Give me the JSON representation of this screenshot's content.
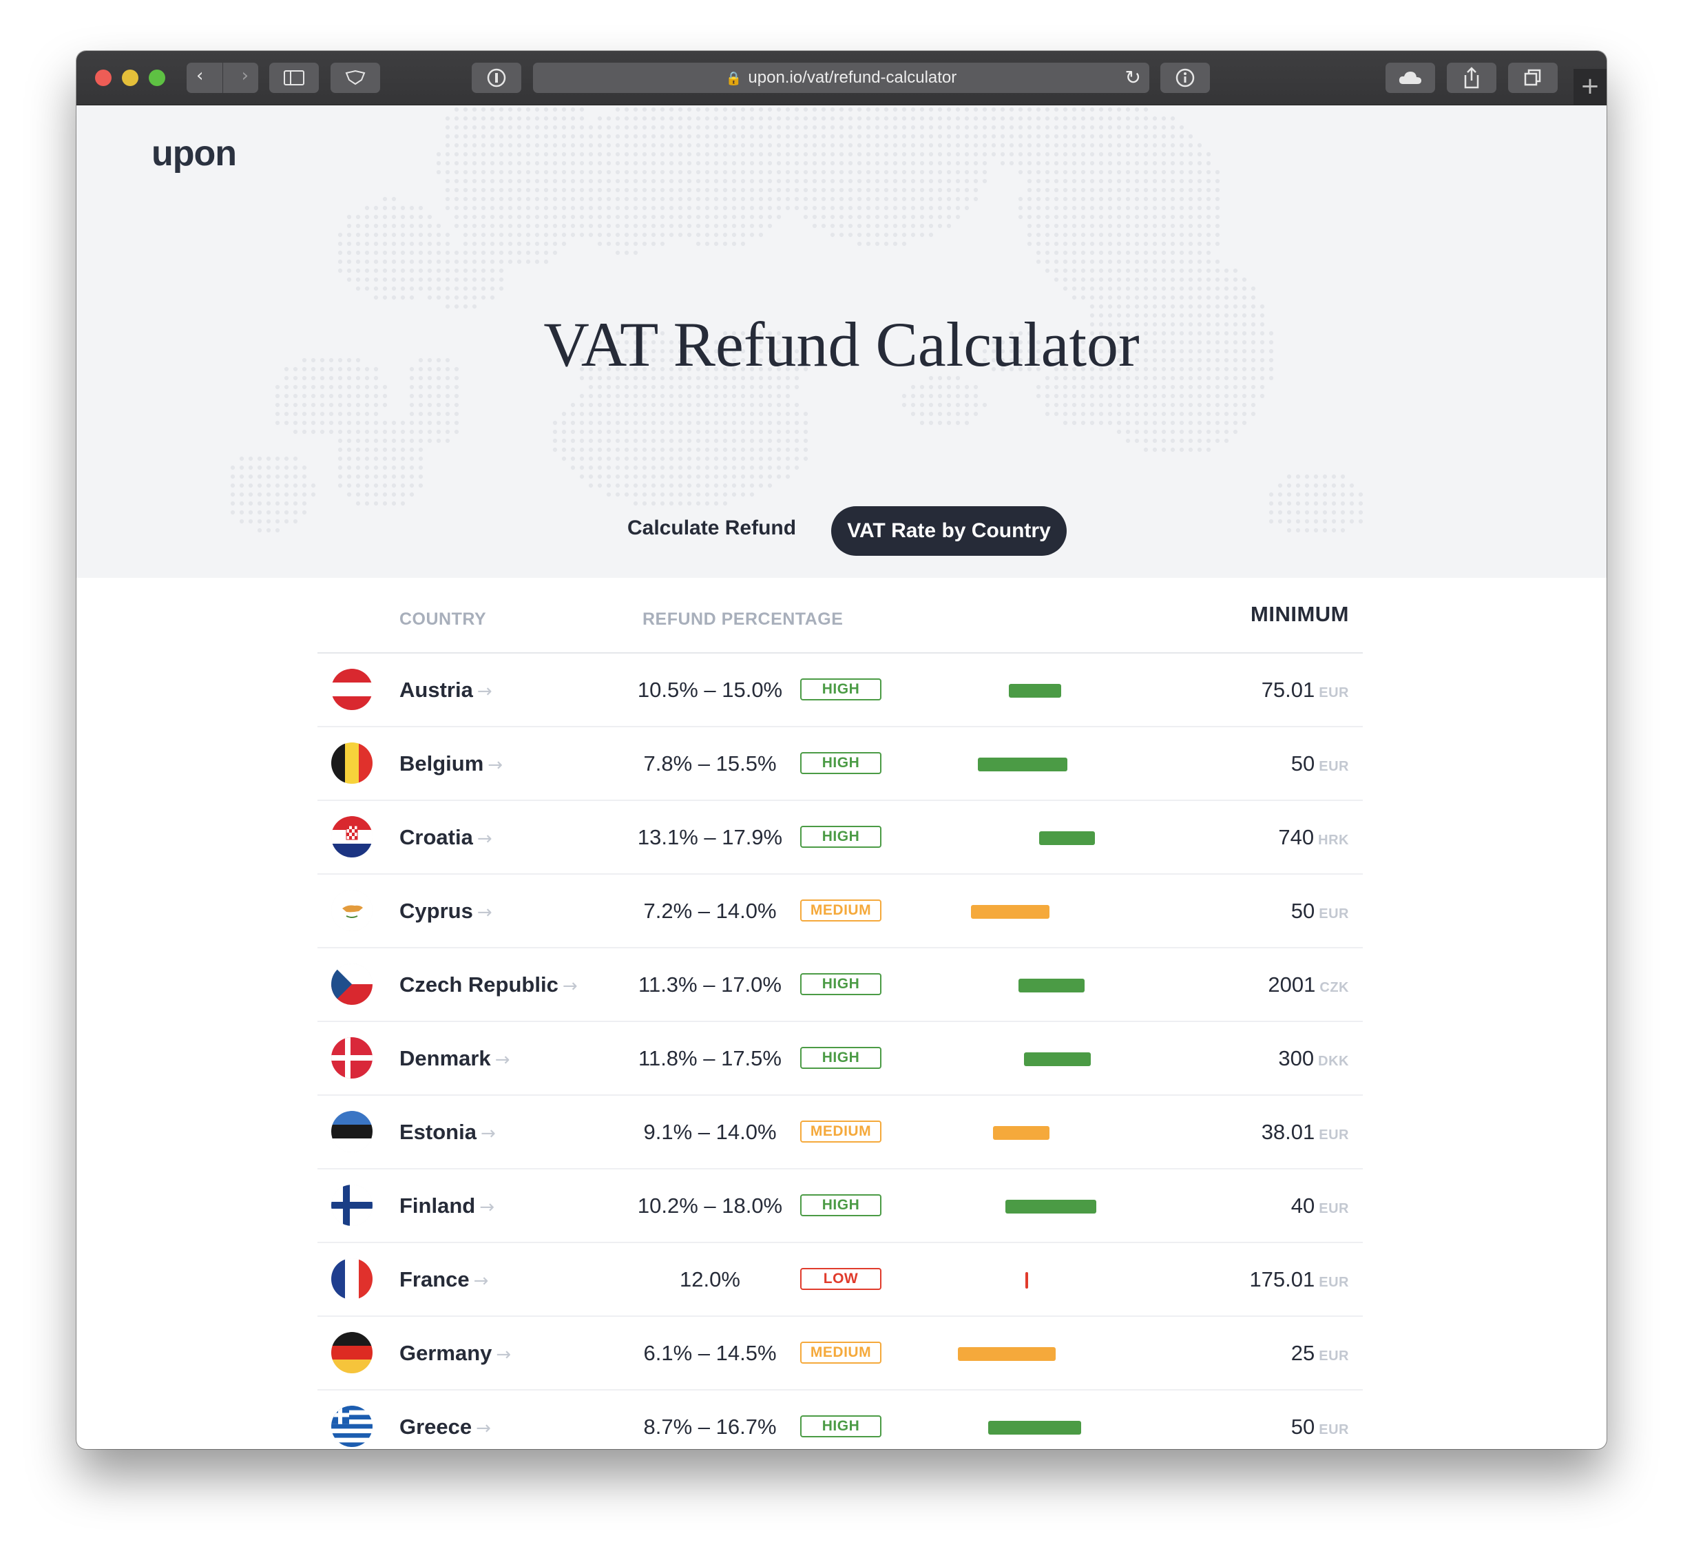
{
  "browser": {
    "url": "upon.io/vat/refund-calculator"
  },
  "site": {
    "logo": "upon",
    "title": "VAT Refund Calculator",
    "tabs": [
      {
        "label": "Calculate Refund",
        "active": false
      },
      {
        "label": "VAT Rate by Country",
        "active": true
      }
    ]
  },
  "table": {
    "headers": {
      "country": "COUNTRY",
      "refund": "REFUND PERCENTAGE",
      "minimum": "MINIMUM"
    },
    "arrow_icon": "arrow-right-icon",
    "rows": [
      {
        "country": "Austria",
        "flag": "austria-flag",
        "range": "10.5% – 15.0%",
        "low_pct": 10.5,
        "high_pct": 15.0,
        "level": "HIGH",
        "minimum": "75.01",
        "currency": "EUR"
      },
      {
        "country": "Belgium",
        "flag": "belgium-flag",
        "range": "7.8% – 15.5%",
        "low_pct": 7.8,
        "high_pct": 15.5,
        "level": "HIGH",
        "minimum": "50",
        "currency": "EUR"
      },
      {
        "country": "Croatia",
        "flag": "croatia-flag",
        "range": "13.1% – 17.9%",
        "low_pct": 13.1,
        "high_pct": 17.9,
        "level": "HIGH",
        "minimum": "740",
        "currency": "HRK"
      },
      {
        "country": "Cyprus",
        "flag": "cyprus-flag",
        "range": "7.2% – 14.0%",
        "low_pct": 7.2,
        "high_pct": 14.0,
        "level": "MEDIUM",
        "minimum": "50",
        "currency": "EUR"
      },
      {
        "country": "Czech Republic",
        "flag": "czech-flag",
        "range": "11.3% – 17.0%",
        "low_pct": 11.3,
        "high_pct": 17.0,
        "level": "HIGH",
        "minimum": "2001",
        "currency": "CZK"
      },
      {
        "country": "Denmark",
        "flag": "denmark-flag",
        "range": "11.8% – 17.5%",
        "low_pct": 11.8,
        "high_pct": 17.5,
        "level": "HIGH",
        "minimum": "300",
        "currency": "DKK"
      },
      {
        "country": "Estonia",
        "flag": "estonia-flag",
        "range": "9.1% – 14.0%",
        "low_pct": 9.1,
        "high_pct": 14.0,
        "level": "MEDIUM",
        "minimum": "38.01",
        "currency": "EUR"
      },
      {
        "country": "Finland",
        "flag": "finland-flag",
        "range": "10.2% – 18.0%",
        "low_pct": 10.2,
        "high_pct": 18.0,
        "level": "HIGH",
        "minimum": "40",
        "currency": "EUR"
      },
      {
        "country": "France",
        "flag": "france-flag",
        "range": "12.0%",
        "low_pct": 12.0,
        "high_pct": 12.0,
        "level": "LOW",
        "minimum": "175.01",
        "currency": "EUR"
      },
      {
        "country": "Germany",
        "flag": "germany-flag",
        "range": "6.1% – 14.5%",
        "low_pct": 6.1,
        "high_pct": 14.5,
        "level": "MEDIUM",
        "minimum": "25",
        "currency": "EUR"
      },
      {
        "country": "Greece",
        "flag": "greece-flag",
        "range": "8.7% – 16.7%",
        "low_pct": 8.7,
        "high_pct": 16.7,
        "level": "HIGH",
        "minimum": "50",
        "currency": "EUR"
      }
    ]
  },
  "colors": {
    "HIGH": "#4b9b45",
    "MEDIUM": "#f5a93b",
    "LOW": "#e03b2c",
    "dark": "#262b38"
  }
}
